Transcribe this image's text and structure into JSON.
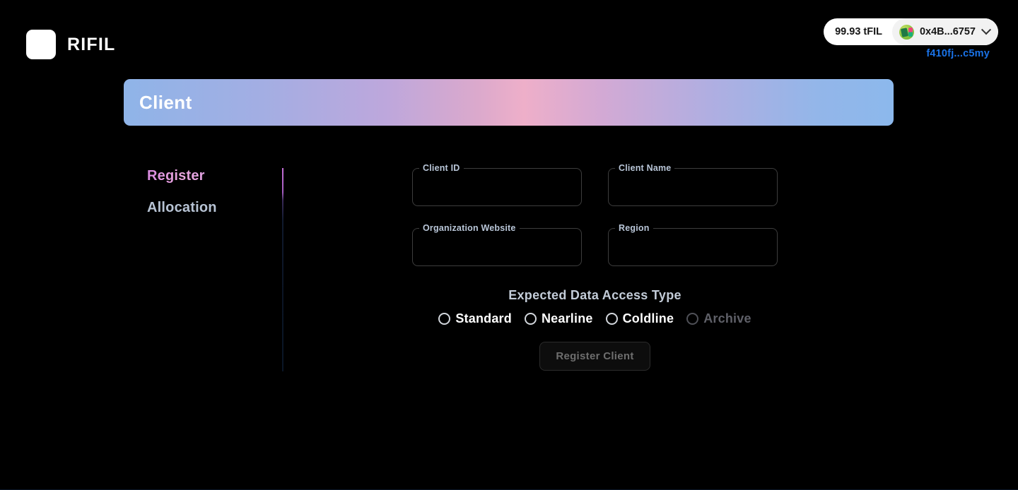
{
  "brand": {
    "logo_icon": "app-logo-square",
    "name": "RIFIL"
  },
  "wallet": {
    "balance": "99.93 tFIL",
    "avatar_icon": "jazzicon-avatar",
    "address": "0x4B...6757",
    "chevron_icon": "chevron-down-icon",
    "fil_address": "f410fj...c5my"
  },
  "banner": {
    "title": "Client"
  },
  "sidebar": {
    "items": [
      {
        "label": "Register",
        "active": true
      },
      {
        "label": "Allocation",
        "active": false
      }
    ]
  },
  "form": {
    "fields": [
      {
        "label": "Client ID",
        "value": "",
        "placeholder": ""
      },
      {
        "label": "Client Name",
        "value": "",
        "placeholder": ""
      },
      {
        "label": "Organization Website",
        "value": "",
        "placeholder": ""
      },
      {
        "label": "Region",
        "value": "",
        "placeholder": ""
      }
    ],
    "access": {
      "title": "Expected Data Access Type",
      "options": [
        {
          "label": "Standard",
          "selected": false,
          "disabled": false
        },
        {
          "label": "Nearline",
          "selected": false,
          "disabled": false
        },
        {
          "label": "Coldline",
          "selected": false,
          "disabled": false
        },
        {
          "label": "Archive",
          "selected": false,
          "disabled": true
        }
      ]
    },
    "submit": {
      "label": "Register Client",
      "disabled": true
    }
  },
  "colors": {
    "background": "#000000",
    "accent_pink": "#e2a0de",
    "accent_blue": "#8fb4e8",
    "link_blue": "#1a73e8",
    "text_muted": "#b7c3d4"
  }
}
